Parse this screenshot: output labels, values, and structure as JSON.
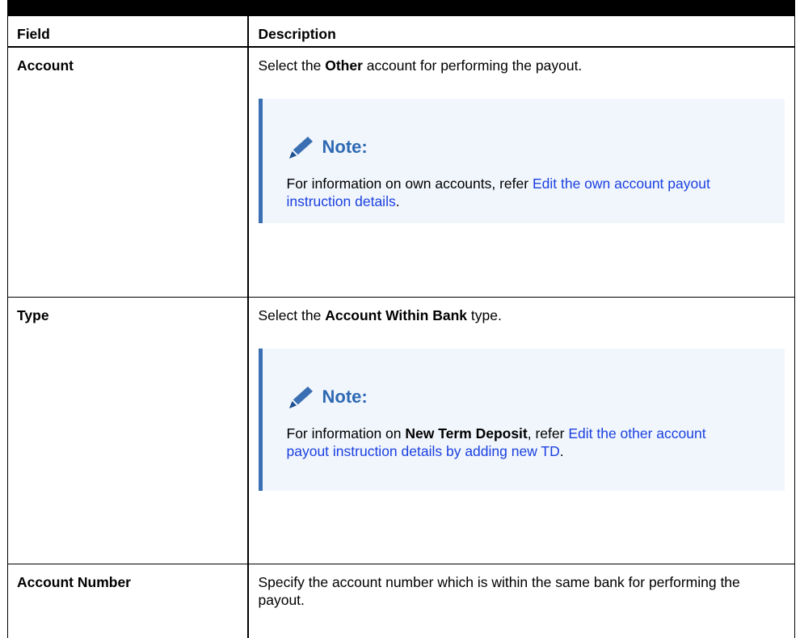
{
  "table": {
    "headers": [
      "Field",
      "Description"
    ],
    "rows": [
      {
        "field": "Account",
        "desc_pre": "Select the ",
        "desc_bold": "Other",
        "desc_post": " account for performing the payout.",
        "note": {
          "title": "Note:",
          "text_pre": "For information on own accounts, refer ",
          "text_bold": "",
          "text_mid": "",
          "link": "Edit the own account payout instruction details",
          "text_post": "."
        }
      },
      {
        "field": "Type",
        "desc_pre": "Select the ",
        "desc_bold": "Account Within Bank",
        "desc_post": " type.",
        "note": {
          "title": "Note:",
          "text_pre": "For information on ",
          "text_bold": "New Term Deposit",
          "text_mid": ", refer ",
          "link": "Edit the other account payout instruction details by adding new TD",
          "text_post": "."
        }
      },
      {
        "field": "Account Number",
        "desc": "Specify the account number which is within the same bank for performing the payout."
      }
    ]
  },
  "icon_name": "pencil-icon",
  "colors": {
    "note_bg": "#f1f6fc",
    "note_border": "#3a6fb3",
    "note_title": "#2e69b3",
    "link": "#1a3fe0"
  }
}
